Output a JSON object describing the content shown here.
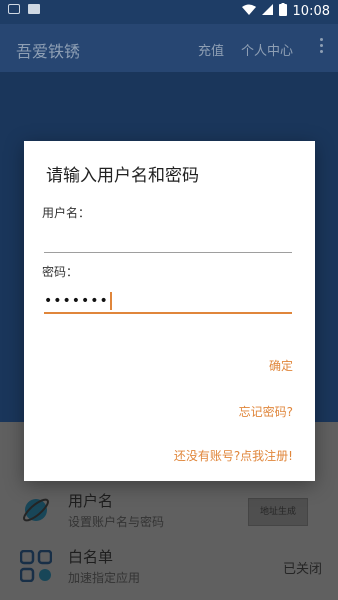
{
  "status_bar": {
    "time": "10:08"
  },
  "app_bar": {
    "title": "吾爱铁锈",
    "recharge": "充值",
    "profile": "个人中心"
  },
  "list": {
    "items": [
      {
        "title": "用户名",
        "subtitle": "设置账户名与密码",
        "chip": "地址生成"
      },
      {
        "title": "白名单",
        "subtitle": "加速指定应用",
        "status": "已关闭"
      }
    ]
  },
  "dialog": {
    "title": "请输入用户名和密码",
    "username_label": "用户名：",
    "username_value": "",
    "password_label": "密码：",
    "password_value": "•••••••",
    "confirm": "确定",
    "forgot": "忘记密码?",
    "register": "还没有账号?点我注册!"
  },
  "colors": {
    "accent": "#e0863b",
    "primary": "#2c4f7f",
    "header": "#1e3d66"
  }
}
